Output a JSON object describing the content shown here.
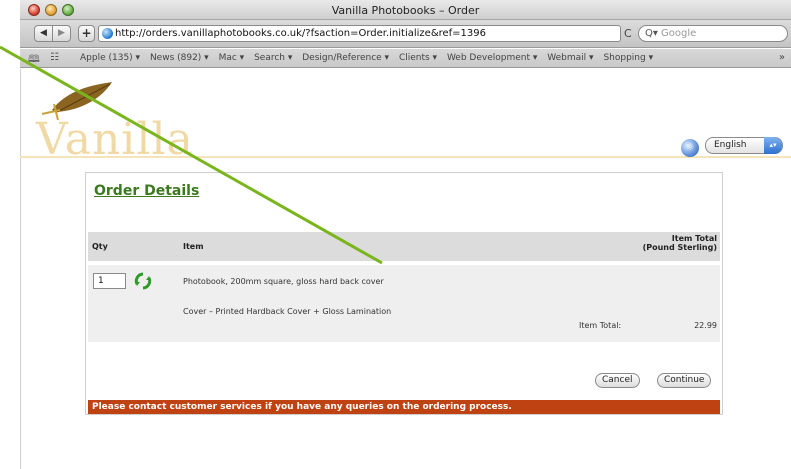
{
  "window": {
    "title": "Vanilla Photobooks – Order"
  },
  "toolbar": {
    "back_label": "◀",
    "forward_label": "▶",
    "add_label": "+",
    "url": "http://orders.vanillaphotobooks.co.uk/?fsaction=Order.initialize&ref=1396",
    "reload_label": "C",
    "search_placeholder": "Google",
    "search_prefix": "Q▾"
  },
  "bookmarks": {
    "items": [
      "Apple (135) ▾",
      "News (892) ▾",
      "Mac ▾",
      "Search ▾",
      "Design/Reference ▾",
      "Clients ▾",
      "Web Development ▾",
      "Webmail ▾",
      "Shopping ▾"
    ],
    "more_label": "»"
  },
  "site": {
    "logo_text": "Vanilla",
    "language": "English"
  },
  "order": {
    "title": "Order Details",
    "headers": {
      "qty": "Qty",
      "item": "Item",
      "total_line1": "Item Total",
      "total_line2": "(Pound Sterling)"
    },
    "row": {
      "qty": "1",
      "item_name": "Photobook, 200mm square, gloss hard back cover",
      "cover": "Cover – Printed Hardback Cover + Gloss Lamination",
      "total_label": "Item Total:",
      "total_value": "22.99"
    },
    "buttons": {
      "cancel": "Cancel",
      "continue": "Continue"
    },
    "notice": "Please contact customer services if you have any queries on the ordering process."
  },
  "colors": {
    "title_green": "#3b7a1f",
    "notice_orange": "#bf4212",
    "annotation_line": "#7ab51d"
  }
}
